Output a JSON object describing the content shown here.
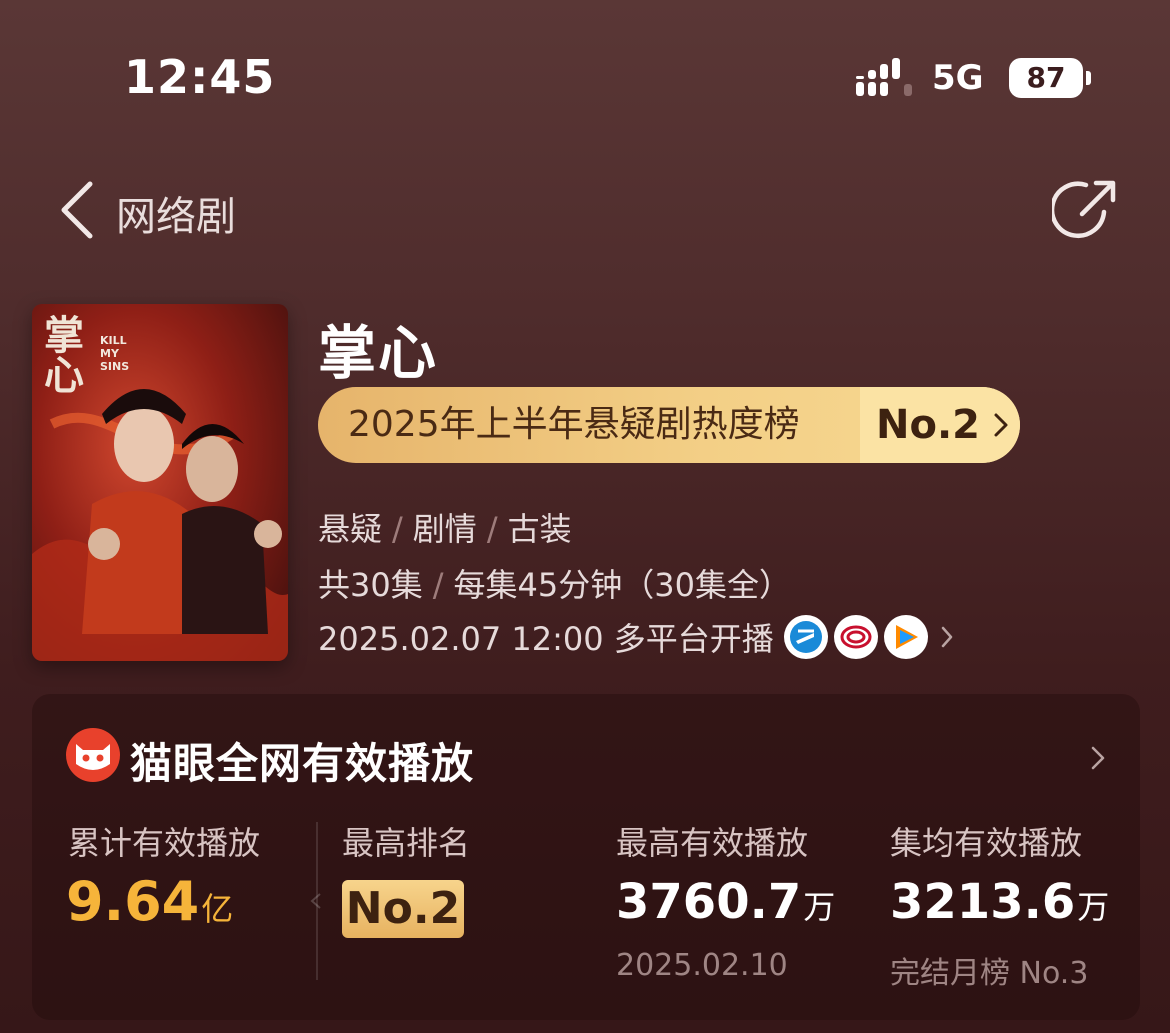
{
  "status": {
    "time": "12:45",
    "network": "5G",
    "battery": "87"
  },
  "nav": {
    "title": "网络剧"
  },
  "show": {
    "title": "掌心",
    "poster_title": "掌心",
    "poster_subtitle": "KILL MY SINS",
    "rank_label": "2025年上半年悬疑剧热度榜",
    "rank_value": "No.2",
    "genres": [
      "悬疑",
      "剧情",
      "古装"
    ],
    "episodes": "共30集",
    "duration": "每集45分钟（30集全）",
    "premiere": "2025.02.07 12:00 多平台开播",
    "platforms": [
      "zhejiang-tv-icon",
      "beijing-tv-icon",
      "tencent-video-icon"
    ]
  },
  "card": {
    "title": "猫眼全网有效播放",
    "stats": {
      "total": {
        "label": "累计有效播放",
        "value": "9.64",
        "unit": "亿"
      },
      "best_rank": {
        "label": "最高排名",
        "value": "No.2"
      },
      "peak": {
        "label": "最高有效播放",
        "value": "3760.7",
        "unit": "万",
        "sub": "2025.02.10"
      },
      "avg": {
        "label": "集均有效播放",
        "value": "3213.6",
        "unit": "万",
        "sub": "完结月榜 No.3"
      }
    }
  },
  "colors": {
    "accent_gold": "#f6b43a",
    "pill_gold": "#f3cf86",
    "bg": "#4f2c2c"
  }
}
